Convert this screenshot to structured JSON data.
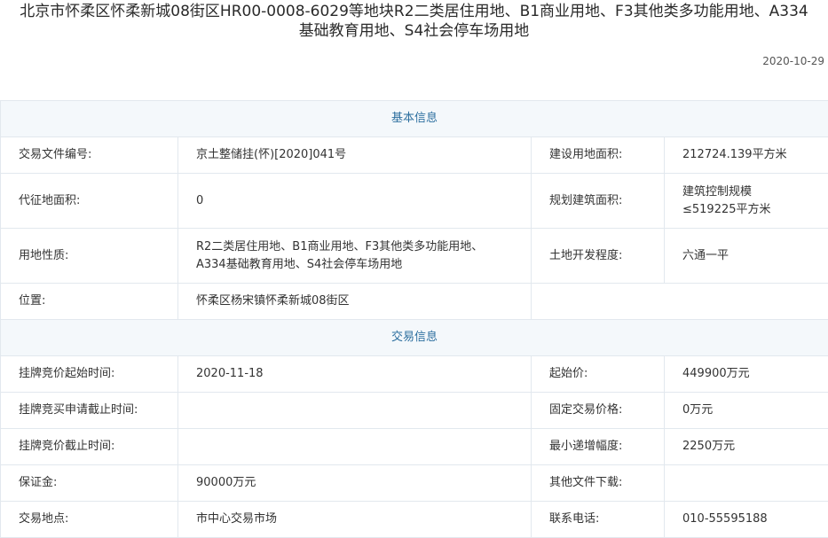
{
  "header": {
    "title_line1": "北京市怀柔区怀柔新城08街区HR00-0008-6029等地块R2二类居住用地、B1商业用地、F3其他类多功能用地、A334",
    "title_line2": "基础教育用地、S4社会停车场用地",
    "date": "2020-10-29"
  },
  "basic": {
    "section_title": "基本信息",
    "file_no_label": "交易文件编号:",
    "file_no": "京土整储挂(怀)[2020]041号",
    "land_area_label": "建设用地面积:",
    "land_area": "212724.139平方米",
    "expropriation_label": "代征地面积:",
    "expropriation": "0",
    "building_area_label": "规划建筑面积:",
    "building_area_line1": "建筑控制规模",
    "building_area_line2": "≤519225平方米",
    "land_use_label": "用地性质:",
    "land_use_line1": "R2二类居住用地、B1商业用地、F3其他类多功能用地、",
    "land_use_line2": "A334基础教育用地、S4社会停车场用地",
    "development_label": "土地开发程度:",
    "development": "六通一平",
    "location_label": "位置:",
    "location": "怀柔区杨宋镇怀柔新城08街区"
  },
  "trade": {
    "section_title": "交易信息",
    "start_time_label": "挂牌竞价起始时间:",
    "start_time": "2020-11-18",
    "start_price_label": "起始价:",
    "start_price": "449900万元",
    "apply_deadline_label": "挂牌竞买申请截止时间:",
    "apply_deadline": "",
    "fixed_price_label": "固定交易价格:",
    "fixed_price": "0万元",
    "bid_deadline_label": "挂牌竞价截止时间:",
    "bid_deadline": "",
    "min_increment_label": "最小递增幅度:",
    "min_increment": "2250万元",
    "deposit_label": "保证金:",
    "deposit": "90000万元",
    "other_files_label": "其他文件下载:",
    "other_files": "",
    "venue_label": "交易地点:",
    "venue": "市中心交易市场",
    "phone_label": "联系电话:",
    "phone": "010-55595188"
  }
}
